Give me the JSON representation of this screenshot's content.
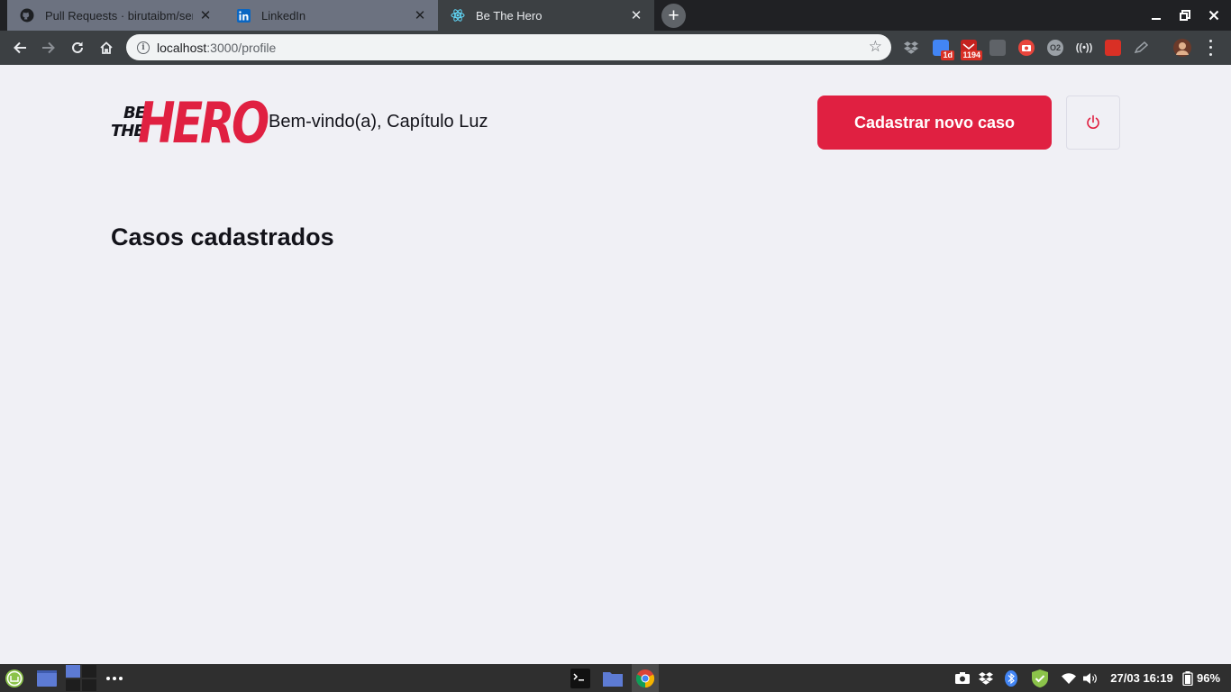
{
  "browser": {
    "tabs": [
      {
        "title": "Pull Requests · birutaibm/sem",
        "icon": "github-icon",
        "active": false
      },
      {
        "title": "LinkedIn",
        "icon": "linkedin-icon",
        "active": false
      },
      {
        "title": "Be The Hero",
        "icon": "react-icon",
        "active": true
      }
    ],
    "close_glyph": "✕",
    "new_tab_glyph": "+",
    "address": {
      "host": "localhost",
      "path": ":3000/profile"
    },
    "extensions": [
      {
        "name": "dropbox-icon",
        "badge": ""
      },
      {
        "name": "calendar-icon",
        "badge": "1d"
      },
      {
        "name": "gmail-icon",
        "badge": "1194"
      },
      {
        "name": "ext-folder-icon",
        "badge": ""
      },
      {
        "name": "screencast-icon",
        "badge": ""
      },
      {
        "name": "o2-icon",
        "badge": "O2"
      },
      {
        "name": "broadcast-icon",
        "badge": ""
      },
      {
        "name": "ext-red-icon",
        "badge": ""
      },
      {
        "name": "ext-pencil-icon",
        "badge": ""
      }
    ]
  },
  "page": {
    "logo": {
      "line1": "BE",
      "line2": "THE",
      "hero": "HERO"
    },
    "welcome": "Bem-vindo(a), Capítulo Luz",
    "new_case_button": "Cadastrar novo caso",
    "section_title": "Casos cadastrados",
    "colors": {
      "brand": "#e02041",
      "background": "#f0f0f5",
      "text": "#13131a"
    }
  },
  "taskbar": {
    "datetime": "27/03 16:19",
    "battery": "96%"
  }
}
